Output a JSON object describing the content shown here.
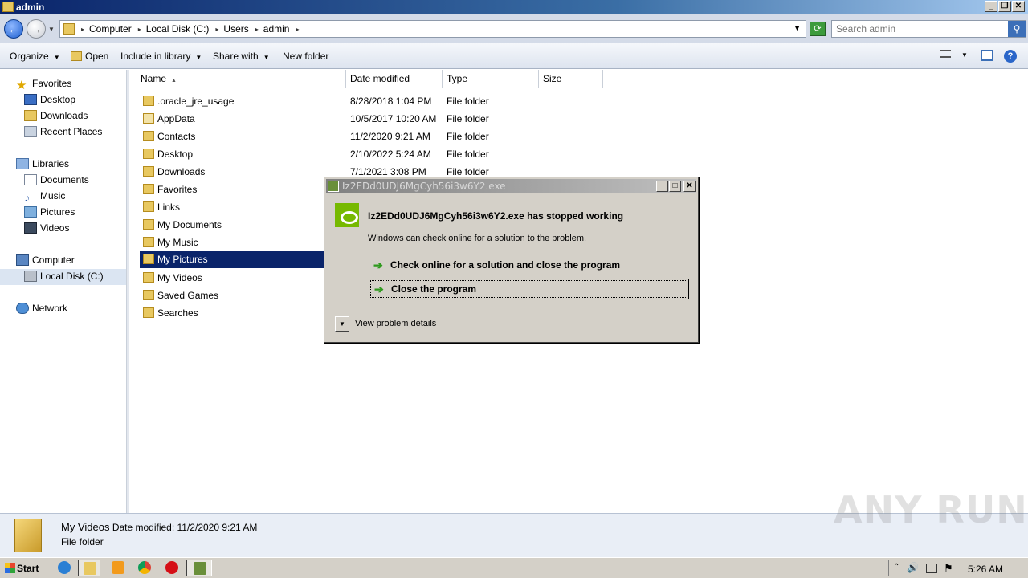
{
  "window": {
    "title": "admin"
  },
  "address": {
    "crumbs": [
      "Computer",
      "Local Disk (C:)",
      "Users",
      "admin"
    ],
    "search_placeholder": "Search admin"
  },
  "toolbar": {
    "organize": "Organize",
    "open": "Open",
    "include": "Include in library",
    "share": "Share with",
    "newfolder": "New folder"
  },
  "nav": {
    "favorites": "Favorites",
    "desktop": "Desktop",
    "downloads": "Downloads",
    "recent": "Recent Places",
    "libraries": "Libraries",
    "documents": "Documents",
    "music": "Music",
    "pictures": "Pictures",
    "videos": "Videos",
    "computer": "Computer",
    "localdisk": "Local Disk (C:)",
    "network": "Network"
  },
  "columns": {
    "name": "Name",
    "date": "Date modified",
    "type": "Type",
    "size": "Size"
  },
  "files": [
    {
      "name": ".oracle_jre_usage",
      "date": "8/28/2018 1:04 PM",
      "type": "File folder"
    },
    {
      "name": "AppData",
      "date": "10/5/2017 10:20 AM",
      "type": "File folder"
    },
    {
      "name": "Contacts",
      "date": "11/2/2020 9:21 AM",
      "type": "File folder"
    },
    {
      "name": "Desktop",
      "date": "2/10/2022 5:24 AM",
      "type": "File folder"
    },
    {
      "name": "Downloads",
      "date": "7/1/2021 3:08 PM",
      "type": "File folder"
    },
    {
      "name": "Favorites",
      "date": "",
      "type": ""
    },
    {
      "name": "Links",
      "date": "",
      "type": ""
    },
    {
      "name": "My Documents",
      "date": "",
      "type": ""
    },
    {
      "name": "My Music",
      "date": "",
      "type": ""
    },
    {
      "name": "My Pictures",
      "date": "",
      "type": ""
    },
    {
      "name": "My Videos",
      "date": "",
      "type": ""
    },
    {
      "name": "Saved Games",
      "date": "",
      "type": ""
    },
    {
      "name": "Searches",
      "date": "",
      "type": ""
    }
  ],
  "details": {
    "name": "My Videos",
    "modified": "Date modified: 11/2/2020 9:21 AM",
    "type": "File folder"
  },
  "watermark": "ANY RUN",
  "dialog": {
    "title": "Iz2EDd0UDJ6MgCyh56i3w6Y2.exe",
    "heading": "Iz2EDd0UDJ6MgCyh56i3w6Y2.exe has stopped working",
    "subtitle": "Windows can check online for a solution to the problem.",
    "option1": "Check online for a solution and close the program",
    "option2": "Close the program",
    "details_toggle": "View problem details"
  },
  "taskbar": {
    "start": "Start",
    "clock": "5:26 AM"
  },
  "colors": {
    "selection": "#0a246a",
    "nvidia": "#76b900",
    "arrow": "#2f9a1e"
  }
}
